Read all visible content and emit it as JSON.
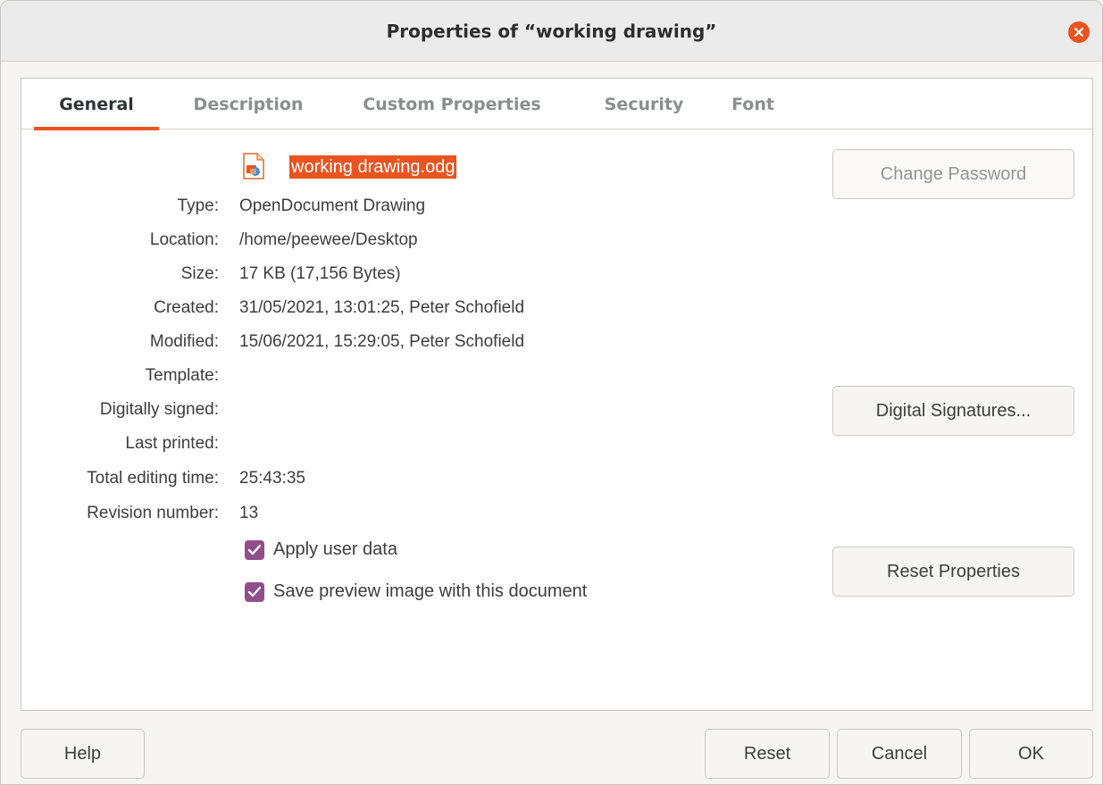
{
  "window": {
    "title": "Properties of “working drawing”"
  },
  "tabs": [
    {
      "label": "General",
      "active": true
    },
    {
      "label": "Description",
      "active": false
    },
    {
      "label": "Custom Properties",
      "active": false
    },
    {
      "label": "Security",
      "active": false
    },
    {
      "label": "Font",
      "active": false
    }
  ],
  "general": {
    "file_icon": "draw-document-icon",
    "filename": "working drawing.odg",
    "fields": [
      {
        "label": "Type:",
        "value": "OpenDocument Drawing"
      },
      {
        "label": "Location:",
        "value": "/home/peewee/Desktop"
      },
      {
        "label": "Size:",
        "value": "17 KB (17,156 Bytes)"
      },
      {
        "label": "Created:",
        "value": "31/05/2021, 13:01:25, Peter Schofield"
      },
      {
        "label": "Modified:",
        "value": "15/06/2021, 15:29:05, Peter Schofield"
      },
      {
        "label": "Template:",
        "value": ""
      },
      {
        "label": "Digitally signed:",
        "value": ""
      },
      {
        "label": "Last printed:",
        "value": ""
      },
      {
        "label": "Total editing time:",
        "value": "25:43:35"
      },
      {
        "label": "Revision number:",
        "value": "13"
      }
    ],
    "checkboxes": [
      {
        "label": "Apply user data",
        "checked": true
      },
      {
        "label": "Save preview image with this document",
        "checked": true
      }
    ],
    "buttons": {
      "change_password": "Change Password",
      "digital_signatures": "Digital Signatures...",
      "reset_properties": "Reset Properties"
    }
  },
  "footer": {
    "help": "Help",
    "reset": "Reset",
    "cancel": "Cancel",
    "ok": "OK"
  },
  "colors": {
    "accent": "#e95420",
    "checkbox": "#924d8b"
  }
}
